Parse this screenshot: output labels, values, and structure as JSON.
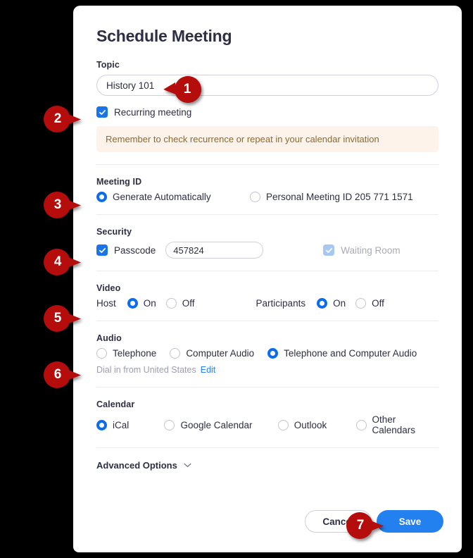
{
  "dialog": {
    "title": "Schedule Meeting"
  },
  "topic": {
    "label": "Topic",
    "value": "History 101",
    "placeholder": "Topic"
  },
  "recurring": {
    "label": "Recurring meeting",
    "checked": true,
    "notice": "Remember to check recurrence or repeat in your calendar invitation"
  },
  "meeting_id": {
    "label": "Meeting ID",
    "options": [
      {
        "label": "Generate Automatically",
        "selected": true
      },
      {
        "label": "Personal Meeting ID 205 771 1571",
        "selected": false
      }
    ]
  },
  "security": {
    "label": "Security",
    "passcode_label": "Passcode",
    "passcode_checked": true,
    "passcode_value": "457824",
    "waiting_room_label": "Waiting Room",
    "waiting_room_checked": true,
    "waiting_room_disabled": true
  },
  "video": {
    "label": "Video",
    "host_label": "Host",
    "host_on": "On",
    "host_off": "Off",
    "host_value": "On",
    "participants_label": "Participants",
    "participants_on": "On",
    "participants_off": "Off",
    "participants_value": "On"
  },
  "audio": {
    "label": "Audio",
    "options": [
      {
        "label": "Telephone",
        "selected": false
      },
      {
        "label": "Computer Audio",
        "selected": false
      },
      {
        "label": "Telephone and Computer Audio",
        "selected": true
      }
    ],
    "dial_in_text": "Dial in from United States",
    "edit_link": "Edit"
  },
  "calendar": {
    "label": "Calendar",
    "options": [
      {
        "label": "iCal",
        "selected": true
      },
      {
        "label": "Google Calendar",
        "selected": false
      },
      {
        "label": "Outlook",
        "selected": false
      },
      {
        "label": "Other Calendars",
        "selected": false
      }
    ]
  },
  "advanced": {
    "label": "Advanced Options",
    "chevron": "chevron-down-icon"
  },
  "footer": {
    "cancel_label": "Cancel",
    "save_label": "Save"
  },
  "callouts": [
    {
      "number": "1",
      "direction": "left",
      "target": "topic-input"
    },
    {
      "number": "2",
      "direction": "right",
      "target": "recurring-checkbox"
    },
    {
      "number": "3",
      "direction": "right",
      "target": "meeting-id-radio"
    },
    {
      "number": "4",
      "direction": "right",
      "target": "passcode-checkbox"
    },
    {
      "number": "5",
      "direction": "right",
      "target": "video-host-radio"
    },
    {
      "number": "6",
      "direction": "right",
      "target": "audio-radio"
    },
    {
      "number": "7",
      "direction": "right",
      "target": "save-button"
    }
  ],
  "colors": {
    "accent_blue": "#2380ef",
    "radio_blue": "#0b6cf0",
    "callout_red": "#b50c0c",
    "notice_bg": "#fdf3ea",
    "notice_text": "#8a6a2e"
  }
}
